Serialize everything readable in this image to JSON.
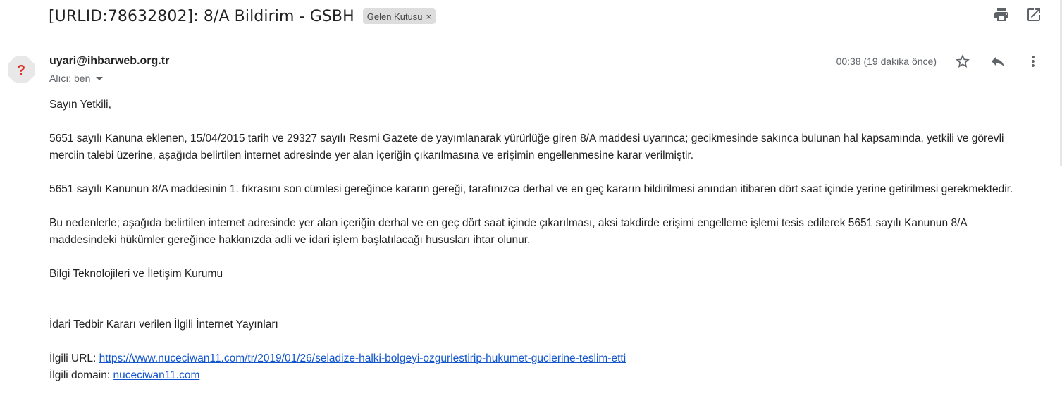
{
  "subject": {
    "title": "[URLID:78632802]: 8/A Bildirim - GSBH",
    "label": "Gelen Kutusu",
    "label_remove": "×"
  },
  "toolbar": {
    "print_icon": "print-icon",
    "open_new_window_icon": "open-in-new-window-icon"
  },
  "message": {
    "avatar_icon": "unknown-sender-question-icon",
    "sender": "uyari@ihbarweb.org.tr",
    "recipient": "Alıcı: ben",
    "time": "00:38 (19 dakika önce)",
    "actions": [
      "star-icon",
      "reply-icon",
      "more-vert-icon"
    ]
  },
  "body": {
    "greeting": "Sayın Yetkili,",
    "paragraph1": "5651 sayılı Kanuna eklenen, 15/04/2015 tarih ve 29327 sayılı Resmi Gazete de yayımlanarak yürürlüğe giren 8/A maddesi uyarınca; gecikmesinde sakınca bulunan hal kapsamında, yetkili ve görevli merciin talebi üzerine, aşağıda belirtilen internet adresinde yer alan içeriğin çıkarılmasına ve erişimin engellenmesine karar verilmiştir.",
    "paragraph2": "5651 sayılı Kanunun 8/A maddesinin 1. fıkrasını son cümlesi gereğince kararın gereği, tarafınızca derhal ve en geç kararın bildirilmesi anından itibaren dört saat içinde yerine getirilmesi gerekmektedir.",
    "paragraph3": "Bu nedenlerle;  aşağıda belirtilen internet adresinde yer alan içeriğin derhal ve en geç dört saat içinde çıkarılması, aksi takdirde erişimi engelleme işlemi tesis edilerek 5651 sayılı Kanunun 8/A maddesindeki hükümler gereğince hakkınızda adli ve idari işlem başlatılacağı hususları ihtar olunur.",
    "signature": "Bilgi Teknolojileri ve İletişim Kurumu",
    "section_title": "İdari Tedbir Kararı verilen İlgili İnternet Yayınları",
    "url_label": "İlgili URL: ",
    "url": "https://www.nuceciwan11.com/tr/2019/01/26/seladize-halki-bolgeyi-ozgurlestirip-hukumet-guclerine-teslim-etti",
    "domain_label": "İlgili domain: ",
    "domain": "nuceciwan11.com"
  },
  "colors": {
    "link": "#1155cc",
    "muted": "#5f6368",
    "chip_bg": "#dddddd",
    "avatar_bg": "#e8e8e8",
    "avatar_mark": "#d93025"
  }
}
